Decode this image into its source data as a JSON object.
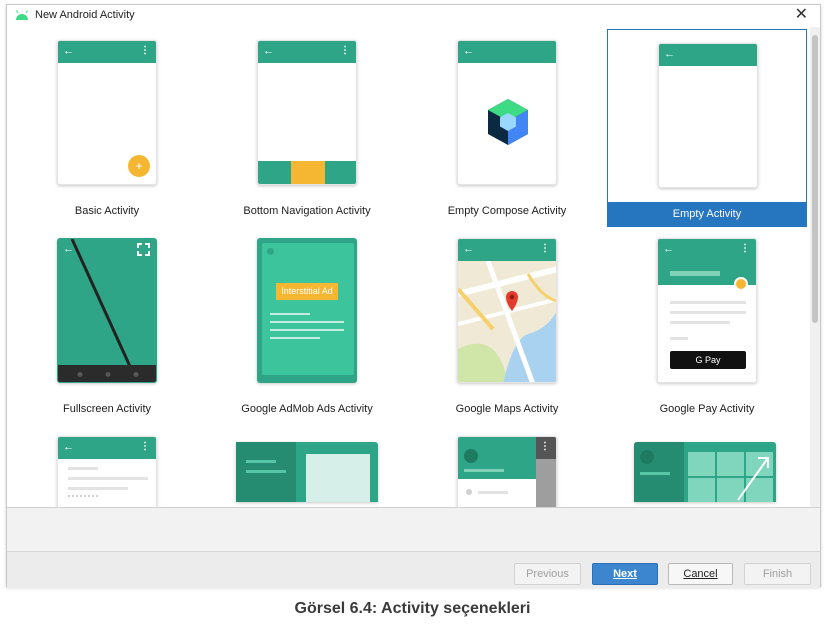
{
  "window": {
    "title": "New Android Activity"
  },
  "templates": [
    {
      "label": "Basic Activity"
    },
    {
      "label": "Bottom Navigation Activity"
    },
    {
      "label": "Empty Compose Activity"
    },
    {
      "label": "Empty Activity",
      "selected": true
    },
    {
      "label": "Fullscreen Activity"
    },
    {
      "label": "Google AdMob Ads Activity",
      "ad_text": "Interstitial Ad"
    },
    {
      "label": "Google Maps Activity"
    },
    {
      "label": "Google Pay Activity",
      "pay_text": "G Pay"
    }
  ],
  "buttons": {
    "previous": "Previous",
    "next": "Next",
    "cancel": "Cancel",
    "finish": "Finish"
  },
  "caption": "Görsel 6.4: Activity seçenekleri",
  "colors": {
    "accent": "#2fa587",
    "selection": "#2675bf",
    "fab": "#f5b731"
  }
}
